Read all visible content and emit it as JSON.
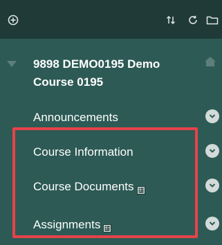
{
  "toolbar": {
    "add_icon": "plus-circle-icon",
    "sort_icon": "sort-arrows-icon",
    "refresh_icon": "refresh-icon",
    "folder_icon": "folder-icon"
  },
  "course": {
    "title": "9898 DEMO0195 Demo Course 0195"
  },
  "menu": {
    "items": [
      {
        "label": "Announcements",
        "has_page_icon": false
      },
      {
        "label": "Course Information",
        "has_page_icon": false
      },
      {
        "label": "Course Documents",
        "has_page_icon": true
      },
      {
        "label": "Assignments",
        "has_page_icon": true
      }
    ]
  },
  "colors": {
    "panel_bg": "#2d5a55",
    "toolbar_bg": "#1f3a37",
    "highlight": "#e8424a"
  }
}
